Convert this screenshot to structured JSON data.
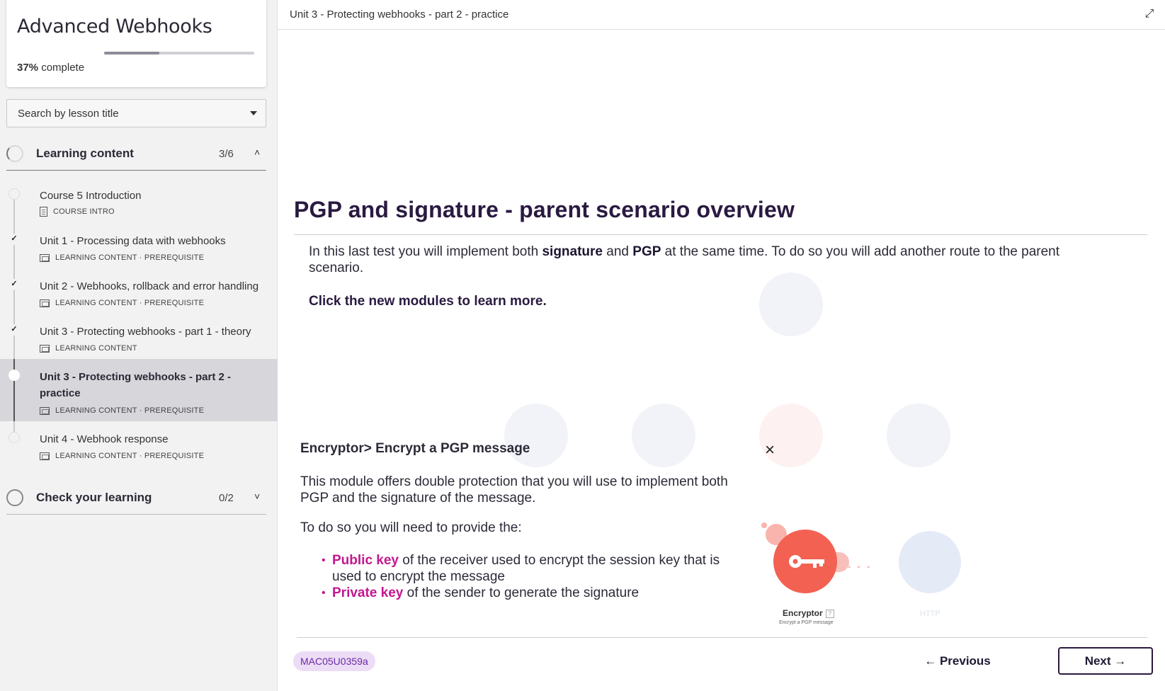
{
  "sidebar": {
    "course_title": "Advanced Webhooks",
    "progress_percent": "37%",
    "progress_suffix": "complete",
    "progress_value": 0.37,
    "search_placeholder": "Search by lesson title",
    "sections": [
      {
        "title": "Learning content",
        "count": "3/6",
        "expanded": true
      },
      {
        "title": "Check your learning",
        "count": "0/2",
        "expanded": false
      }
    ],
    "lessons": [
      {
        "title": "Course 5 Introduction",
        "meta": "COURSE INTRO",
        "done": false
      },
      {
        "title": "Unit 1 - Processing data with webhooks",
        "meta": "LEARNING CONTENT · PREREQUISITE",
        "done": true
      },
      {
        "title": "Unit 2 - Webhooks, rollback and error handling",
        "meta": "LEARNING CONTENT · PREREQUISITE",
        "done": true
      },
      {
        "title": "Unit 3 - Protecting webhooks - part 1 - theory",
        "meta": "LEARNING CONTENT",
        "done": true
      },
      {
        "title": "Unit 3 - Protecting webhooks - part 2 - practice",
        "meta": "LEARNING CONTENT · PREREQUISITE",
        "done": false,
        "active": true
      },
      {
        "title": "Unit 4 - Webhook response",
        "meta": "LEARNING CONTENT · PREREQUISITE",
        "done": false
      }
    ]
  },
  "main": {
    "breadcrumb": "Unit 3 - Protecting webhooks - part 2 - practice",
    "page_title": "PGP and signature - parent scenario overview",
    "intro": {
      "part1": "In this last test you will implement both ",
      "bold1": "signature",
      "part2": " and ",
      "bold2": "PGP",
      "part3": " at the same time. To do so you will add another route to the parent scenario."
    },
    "cta": "Click the new modules to learn more.",
    "module": {
      "title": "Encryptor> Encrypt a PGP message",
      "close": "×",
      "description": "This module offers double protection that you will use to implement both PGP and the signature of the message.",
      "need": "To do so you will need to provide the:",
      "bullets": [
        {
          "term": "Public key",
          "rest": " of the receiver used to encrypt the session key that is used to encrypt the message"
        },
        {
          "term": "Private key",
          "rest": " of the sender to generate the signature"
        }
      ],
      "node_label": "Encryptor",
      "node_badge": "?",
      "node_sub": "Encrypt a PGP message",
      "http_label": "HTTP"
    },
    "lesson_code": "MAC05U0359a",
    "prev_label": "Previous",
    "next_label": "Next"
  },
  "colors": {
    "accent_magenta": "#c2178f",
    "title_purple": "#2a1a40",
    "encryptor_red": "#f26152",
    "badge_bg": "#ecdcf5"
  }
}
